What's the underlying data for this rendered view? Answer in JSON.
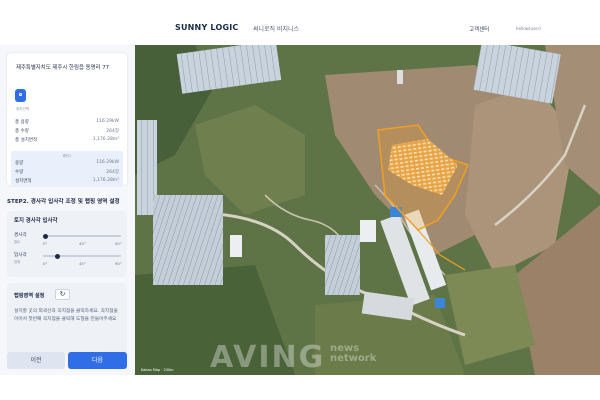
{
  "header": {
    "brand": "SUNNY LOGIC",
    "brand_sub": "써니로직 비지니스",
    "support": "고객센터",
    "user": "hellow(user)"
  },
  "location": {
    "address": "제주특별자치도 제주시 한림읍 동명리 77",
    "locate_caption": "위치선택",
    "summary": [
      {
        "label": "총 용량",
        "value": "116.29kW"
      },
      {
        "label": "총 수량",
        "value": "264장"
      },
      {
        "label": "총 설치면적",
        "value": "1,176.28m²"
      }
    ],
    "selected_caption": "패턴1",
    "selected": [
      {
        "label": "용량",
        "value": "116.29kW"
      },
      {
        "label": "수량",
        "value": "264장"
      },
      {
        "label": "설치면적",
        "value": "1,176.28m²"
      }
    ]
  },
  "step2": {
    "title": "STEP2. 경사각 입사각 조정 및 랩핑 영역 설정",
    "angle_title": "토지 경사각 입사각",
    "tilt": {
      "label": "경사각",
      "sub": "틸트",
      "value_deg": 0
    },
    "incidence": {
      "label": "입사각",
      "sub": "방위",
      "value_deg": 15
    },
    "ticks": [
      "0°",
      "45°",
      "90°"
    ],
    "range_title": "랩핑영역 설정",
    "refresh_icon": "refresh-icon",
    "range_help": "설치할 곳의 외곽선과 꼭지점을 클릭하세요. 꼭지점을 이어서 첫번째 꼭지점을 클릭해 도형을 만들어주세요"
  },
  "buttons": {
    "prev": "이전",
    "next": "다음"
  },
  "map": {
    "scale_caption": "Kakao Map · 200m"
  },
  "watermark": {
    "main": "AVING",
    "side1": "news",
    "side2": "network"
  },
  "colors": {
    "accent": "#2f6ee6",
    "selection": "#f0a020"
  }
}
